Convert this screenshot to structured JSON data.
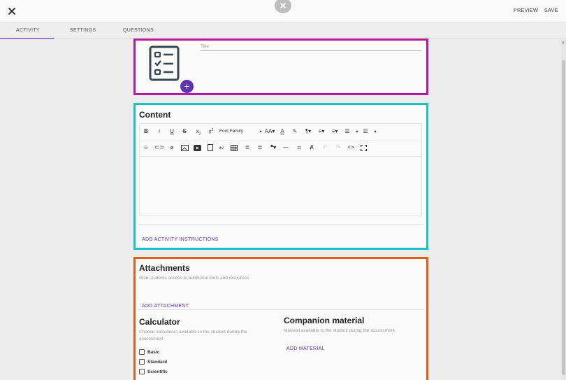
{
  "topbar": {
    "close_icon": "close-icon",
    "preview_label": "PREVIEW",
    "save_label": "SAVE"
  },
  "tabs": [
    {
      "label": "ACTIVITY",
      "active": true
    },
    {
      "label": "SETTINGS",
      "active": false
    },
    {
      "label": "QUESTIONS",
      "active": false
    }
  ],
  "header_section": {
    "icon": "checklist-icon",
    "title_placeholder": "Title",
    "add_icon": "plus-icon"
  },
  "content_section": {
    "heading": "Content",
    "font_family_label": "Font Family",
    "add_instructions_label": "ADD ACTIVITY INSTRUCTIONS"
  },
  "attachments_section": {
    "heading": "Attachments",
    "description": "Give students access to additional tools and resources",
    "add_attachment_label": "ADD ATTACHMENT"
  },
  "calculator_section": {
    "heading": "Calculator",
    "description": "Choose calculators available to the student during the assessment",
    "options": [
      {
        "label": "Basic",
        "checked": false
      },
      {
        "label": "Standard",
        "checked": false
      },
      {
        "label": "Scientific",
        "checked": false
      }
    ]
  },
  "companion_section": {
    "heading": "Companion material",
    "description": "Material available to the student during the assessment",
    "add_material_label": "ADD MATERIAL"
  },
  "colors": {
    "accent": "#5e35b1",
    "highlight_magenta": "#b5199d",
    "highlight_cyan": "#1bc3c3",
    "highlight_orange": "#e85d1a"
  }
}
